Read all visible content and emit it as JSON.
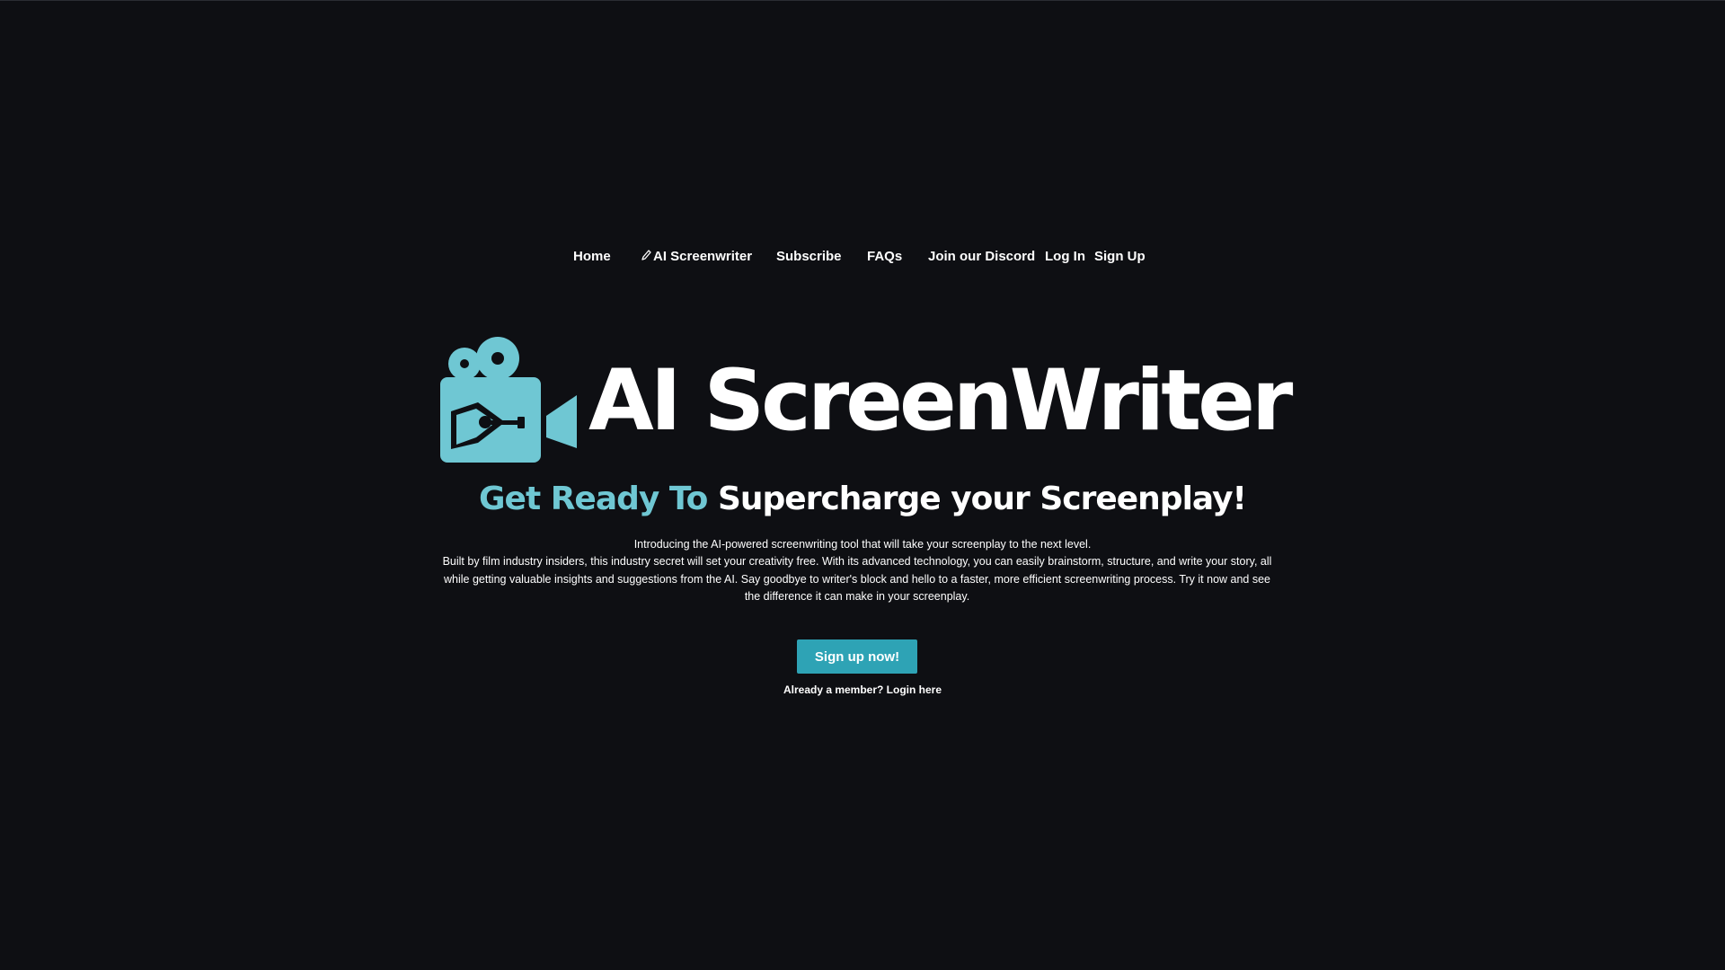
{
  "nav": {
    "home": "Home",
    "ai_screenwriter": "AI Screenwriter",
    "subscribe": "Subscribe",
    "faqs": "FAQs",
    "discord": "Join our Discord",
    "login": "Log In",
    "signup": "Sign Up",
    "pencil_icon": "pencil-icon"
  },
  "logo": {
    "text": "AI ScreenWriter",
    "icon": "film-camera-pen-icon",
    "color": "#6fc7d3"
  },
  "hero": {
    "tagline_accent": "Get Ready To",
    "tagline_rest": "Supercharge your Screenplay!",
    "intro": "Introducing the AI-powered screenwriting tool that will take your screenplay to the next level.",
    "description": "Built by film industry insiders, this industry secret will set your creativity free. With its advanced technology, you can easily brainstorm, structure, and write your story, all while getting valuable insights and suggestions from the AI. Say goodbye to writer's block and hello to a faster, more efficient screenwriting process. Try it now and see the difference it can make in your screenplay.",
    "cta_label": "Sign up now!",
    "login_text": "Already a member? Login here"
  },
  "colors": {
    "background": "#0e0f13",
    "accent": "#6fc7d3",
    "button": "#2ea3b5",
    "text": "#ffffff"
  }
}
